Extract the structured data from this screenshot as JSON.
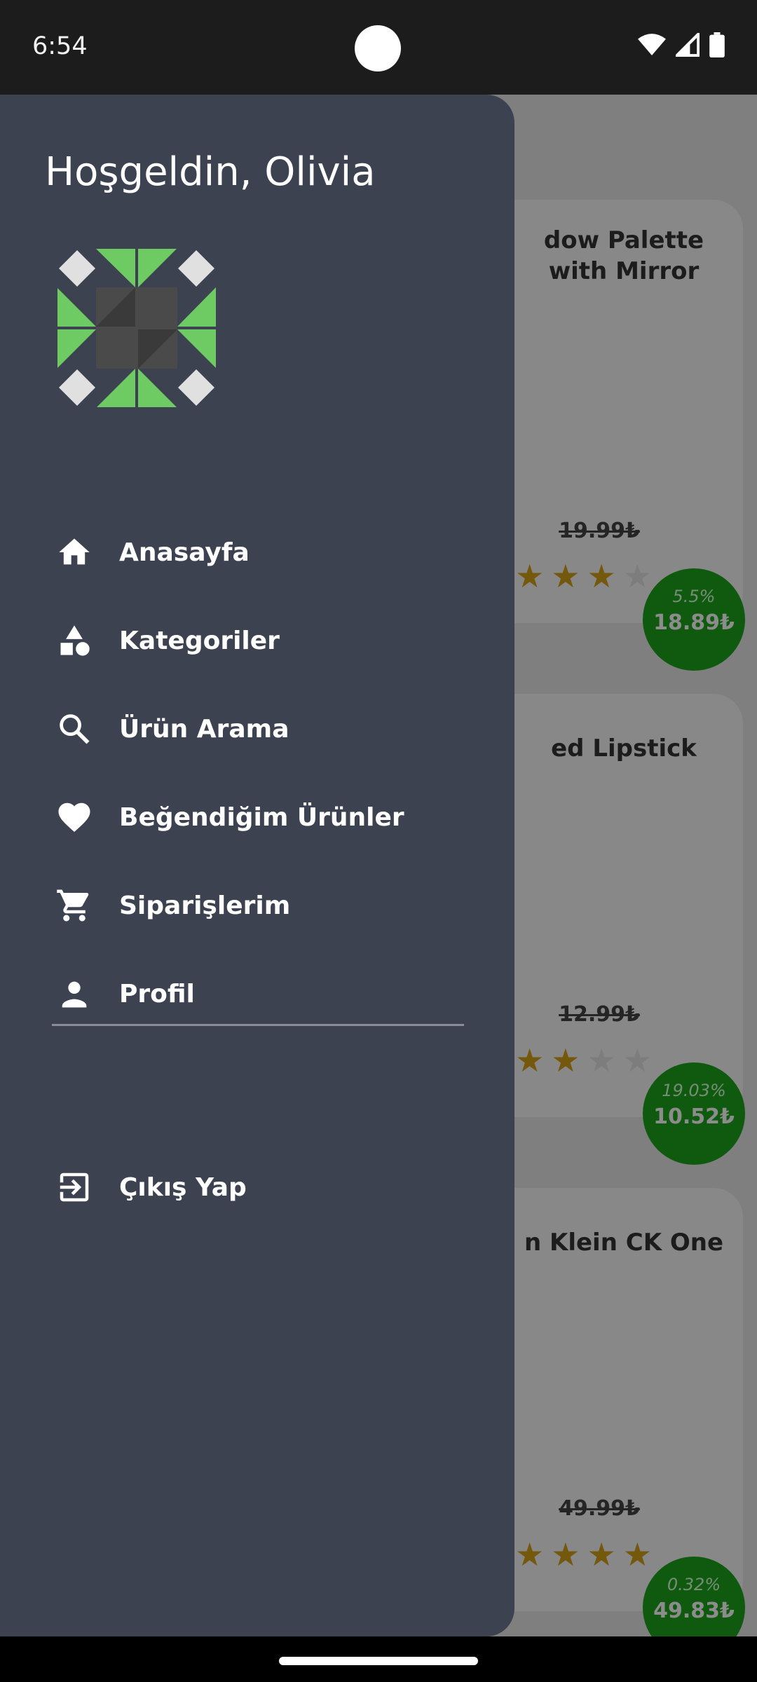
{
  "status_bar": {
    "time": "6:54"
  },
  "drawer": {
    "greeting": "Hoşgeldin, Olivia",
    "menu": [
      {
        "label": "Anasayfa",
        "icon": "home-icon"
      },
      {
        "label": "Kategoriler",
        "icon": "category-icon"
      },
      {
        "label": "Ürün Arama",
        "icon": "search-icon"
      },
      {
        "label": "Beğendiğim Ürünler",
        "icon": "heart-icon"
      },
      {
        "label": "Siparişlerim",
        "icon": "cart-icon"
      },
      {
        "label": "Profil",
        "icon": "person-icon"
      }
    ],
    "logout": {
      "label": "Çıkış Yap",
      "icon": "logout-icon"
    }
  },
  "products": [
    {
      "title": "dow Palette with Mirror",
      "old_price": "19.99₺",
      "discount": "5.5%",
      "price": "18.89₺",
      "rating": 3.5
    },
    {
      "title": "ed Lipstick",
      "old_price": "12.99₺",
      "discount": "19.03%",
      "price": "10.52₺",
      "rating": 2.5
    },
    {
      "title": "n Klein CK One",
      "old_price": "49.99₺",
      "discount": "0.32%",
      "price": "49.83₺",
      "rating": 4
    }
  ],
  "colors": {
    "drawer_bg": "#3d4250",
    "badge_green": "#1ea51e",
    "star_gold": "#d4a017"
  }
}
